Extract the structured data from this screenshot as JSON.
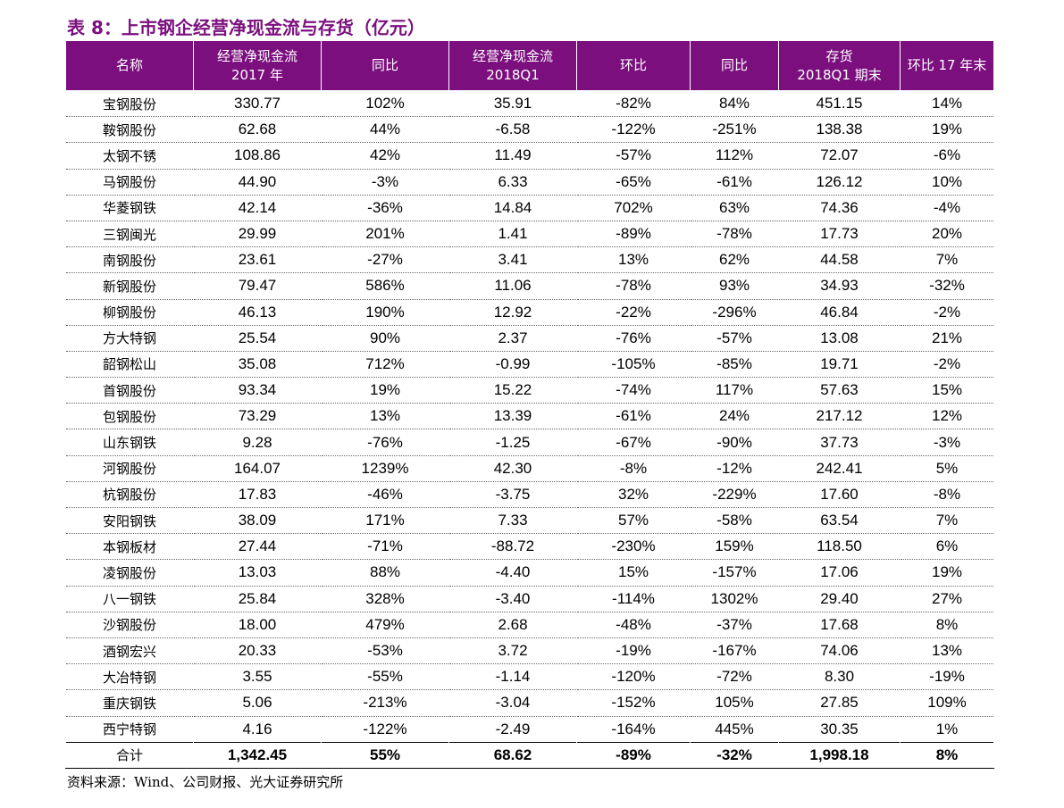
{
  "title": "表 8：上市钢企经营净现金流与存货（亿元）",
  "colors": {
    "header_bg": "#7b0f7e",
    "title": "#7b0f7e"
  },
  "headers": [
    [
      "名称"
    ],
    [
      "经营净现金流",
      "2017 年"
    ],
    [
      "同比"
    ],
    [
      "经营净现金流",
      "2018Q1"
    ],
    [
      "环比"
    ],
    [
      "同比"
    ],
    [
      "存货",
      "2018Q1 期末"
    ],
    [
      "环比 17 年末"
    ]
  ],
  "rows": [
    [
      "宝钢股份",
      "330.77",
      "102%",
      "35.91",
      "-82%",
      "84%",
      "451.15",
      "14%"
    ],
    [
      "鞍钢股份",
      "62.68",
      "44%",
      "-6.58",
      "-122%",
      "-251%",
      "138.38",
      "19%"
    ],
    [
      "太钢不锈",
      "108.86",
      "42%",
      "11.49",
      "-57%",
      "112%",
      "72.07",
      "-6%"
    ],
    [
      "马钢股份",
      "44.90",
      "-3%",
      "6.33",
      "-65%",
      "-61%",
      "126.12",
      "10%"
    ],
    [
      "华菱钢铁",
      "42.14",
      "-36%",
      "14.84",
      "702%",
      "63%",
      "74.36",
      "-4%"
    ],
    [
      "三钢闽光",
      "29.99",
      "201%",
      "1.41",
      "-89%",
      "-78%",
      "17.73",
      "20%"
    ],
    [
      "南钢股份",
      "23.61",
      "-27%",
      "3.41",
      "13%",
      "62%",
      "44.58",
      "7%"
    ],
    [
      "新钢股份",
      "79.47",
      "586%",
      "11.06",
      "-78%",
      "93%",
      "34.93",
      "-32%"
    ],
    [
      "柳钢股份",
      "46.13",
      "190%",
      "12.92",
      "-22%",
      "-296%",
      "46.84",
      "-2%"
    ],
    [
      "方大特钢",
      "25.54",
      "90%",
      "2.37",
      "-76%",
      "-57%",
      "13.08",
      "21%"
    ],
    [
      "韶钢松山",
      "35.08",
      "712%",
      "-0.99",
      "-105%",
      "-85%",
      "19.71",
      "-2%"
    ],
    [
      "首钢股份",
      "93.34",
      "19%",
      "15.22",
      "-74%",
      "117%",
      "57.63",
      "15%"
    ],
    [
      "包钢股份",
      "73.29",
      "13%",
      "13.39",
      "-61%",
      "24%",
      "217.12",
      "12%"
    ],
    [
      "山东钢铁",
      "9.28",
      "-76%",
      "-1.25",
      "-67%",
      "-90%",
      "37.73",
      "-3%"
    ],
    [
      "河钢股份",
      "164.07",
      "1239%",
      "42.30",
      "-8%",
      "-12%",
      "242.41",
      "5%"
    ],
    [
      "杭钢股份",
      "17.83",
      "-46%",
      "-3.75",
      "32%",
      "-229%",
      "17.60",
      "-8%"
    ],
    [
      "安阳钢铁",
      "38.09",
      "171%",
      "7.33",
      "57%",
      "-58%",
      "63.54",
      "7%"
    ],
    [
      "本钢板材",
      "27.44",
      "-71%",
      "-88.72",
      "-230%",
      "159%",
      "118.50",
      "6%"
    ],
    [
      "凌钢股份",
      "13.03",
      "88%",
      "-4.40",
      "15%",
      "-157%",
      "17.06",
      "19%"
    ],
    [
      "八一钢铁",
      "25.84",
      "328%",
      "-3.40",
      "-114%",
      "1302%",
      "29.40",
      "27%"
    ],
    [
      "沙钢股份",
      "18.00",
      "479%",
      "2.68",
      "-48%",
      "-37%",
      "17.68",
      "8%"
    ],
    [
      "酒钢宏兴",
      "20.33",
      "-53%",
      "3.72",
      "-19%",
      "-167%",
      "74.06",
      "13%"
    ],
    [
      "大冶特钢",
      "3.55",
      "-55%",
      "-1.14",
      "-120%",
      "-72%",
      "8.30",
      "-19%"
    ],
    [
      "重庆钢铁",
      "5.06",
      "-213%",
      "-3.04",
      "-152%",
      "105%",
      "27.85",
      "109%"
    ],
    [
      "西宁特钢",
      "4.16",
      "-122%",
      "-2.49",
      "-164%",
      "445%",
      "30.35",
      "1%"
    ]
  ],
  "total": [
    "合计",
    "1,342.45",
    "55%",
    "68.62",
    "-89%",
    "-32%",
    "1,998.18",
    "8%"
  ],
  "source": "资料来源：Wind、公司财报、光大证券研究所"
}
